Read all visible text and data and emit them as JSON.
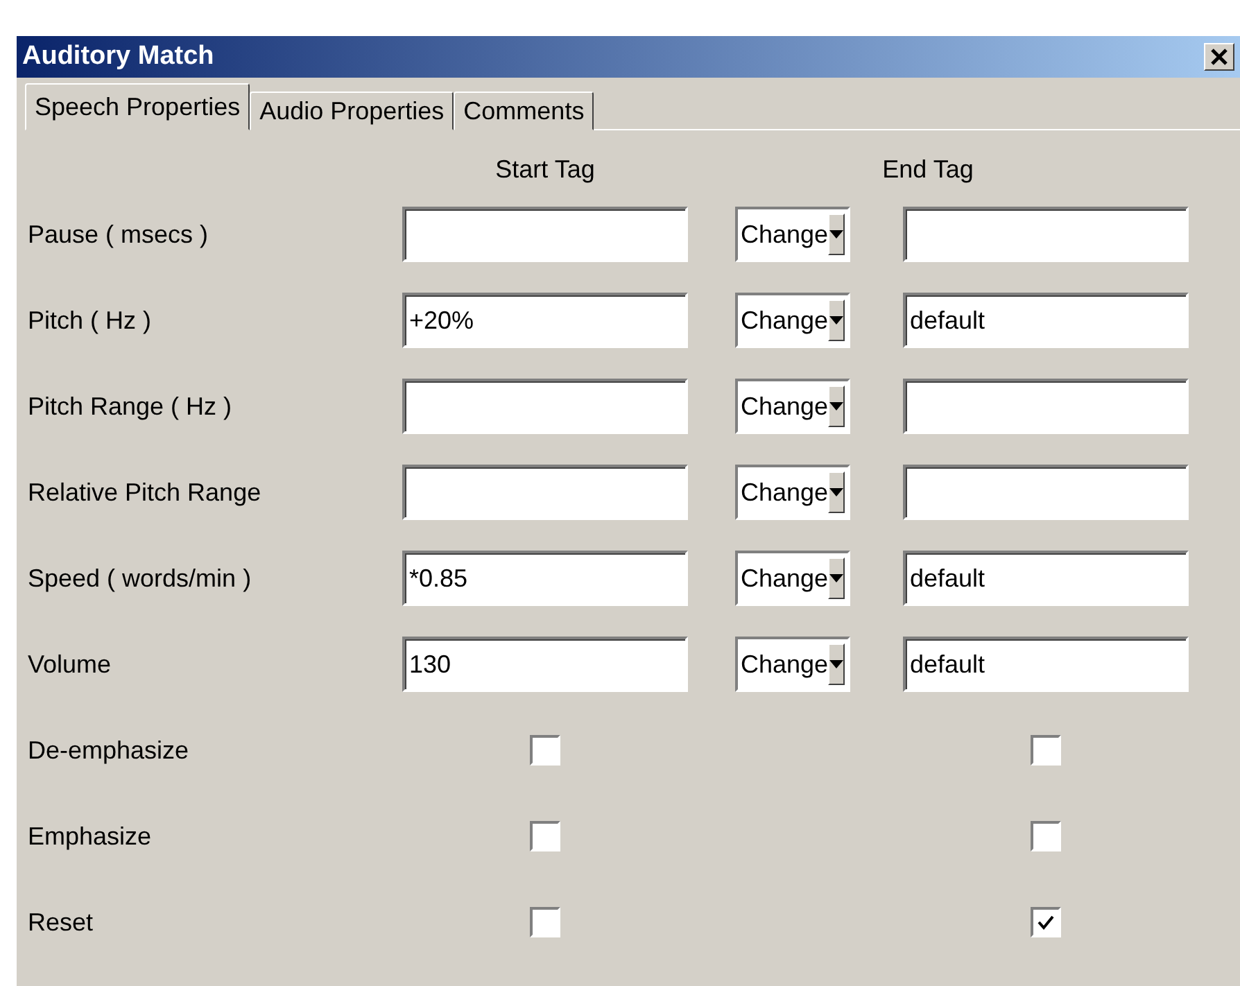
{
  "window": {
    "title": "Auditory Match"
  },
  "tabs": [
    {
      "label": "Speech Properties",
      "selected": true
    },
    {
      "label": "Audio Properties",
      "selected": false
    },
    {
      "label": "Comments",
      "selected": false
    }
  ],
  "headers": {
    "start": "Start Tag",
    "end": "End Tag"
  },
  "rows": [
    {
      "kind": "text",
      "label": "Pause ( msecs )",
      "start": "",
      "mode": "Change",
      "end": ""
    },
    {
      "kind": "text",
      "label": "Pitch ( Hz )",
      "start": "+20%",
      "mode": "Change",
      "end": "default"
    },
    {
      "kind": "text",
      "label": "Pitch Range ( Hz )",
      "start": "",
      "mode": "Change",
      "end": ""
    },
    {
      "kind": "text",
      "label": "Relative Pitch Range",
      "start": "",
      "mode": "Change",
      "end": ""
    },
    {
      "kind": "text",
      "label": "Speed ( words/min )",
      "start": "*0.85",
      "mode": "Change",
      "end": "default"
    },
    {
      "kind": "text",
      "label": "Volume",
      "start": "130",
      "mode": "Change",
      "end": "default"
    },
    {
      "kind": "checkbox",
      "label": "De-emphasize",
      "start_checked": false,
      "end_checked": false
    },
    {
      "kind": "checkbox",
      "label": "Emphasize",
      "start_checked": false,
      "end_checked": false
    },
    {
      "kind": "checkbox",
      "label": "Reset",
      "start_checked": false,
      "end_checked": true
    }
  ]
}
